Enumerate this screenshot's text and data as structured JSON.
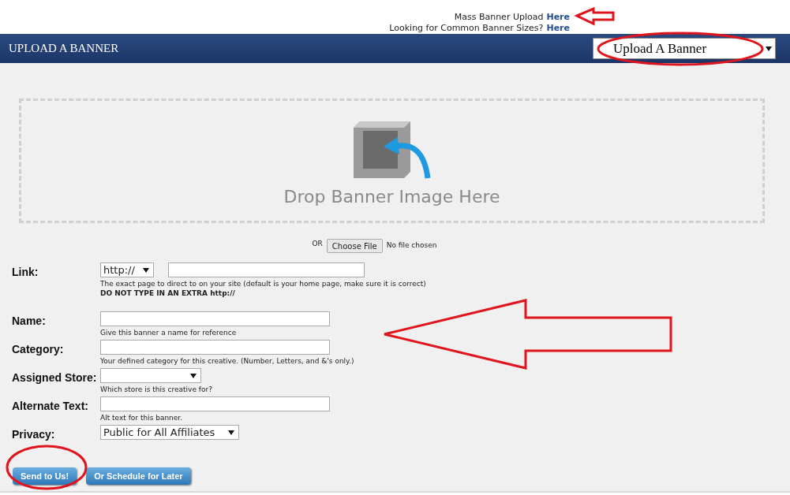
{
  "top_links": [
    {
      "text": "Mass Banner Upload",
      "link": "Here"
    },
    {
      "text": "Looking for Common Banner Sizes?",
      "link": "Here"
    }
  ],
  "header": {
    "title": "UPLOAD A BANNER",
    "select": "Upload A Banner"
  },
  "dropzone": {
    "text": "Drop Banner Image Here"
  },
  "file": {
    "or": "OR",
    "button": "Choose File",
    "status": "No file chosen"
  },
  "fields": [
    {
      "label": "Link:",
      "kind": "select_input",
      "select": "http://",
      "hints": [
        {
          "text": "The exact page to direct to on your site (default is your home page, make sure it is correct)",
          "bold": false
        },
        {
          "text": "DO NOT TYPE IN AN EXTRA http://",
          "bold": true
        }
      ]
    },
    {
      "label": "Name:",
      "kind": "input",
      "hints": [
        {
          "text": "Give this banner a name for reference",
          "bold": false
        }
      ]
    },
    {
      "label": "Category:",
      "kind": "input",
      "hints": [
        {
          "text": "Your defined category for this creative. (Number, Letters, and &'s only.)",
          "bold": false
        }
      ]
    },
    {
      "label": "Assigned Store:",
      "kind": "select",
      "hints": [
        {
          "text": "Which store is this creative for?",
          "bold": false
        }
      ]
    },
    {
      "label": "Alternate Text:",
      "kind": "input",
      "hints": [
        {
          "text": "Alt text for this banner.",
          "bold": false
        }
      ]
    },
    {
      "label": "Privacy:",
      "kind": "select",
      "select": "Public for All Affiliates"
    }
  ],
  "buttons": [
    "Send to Us!",
    "Or Schedule for Later"
  ]
}
